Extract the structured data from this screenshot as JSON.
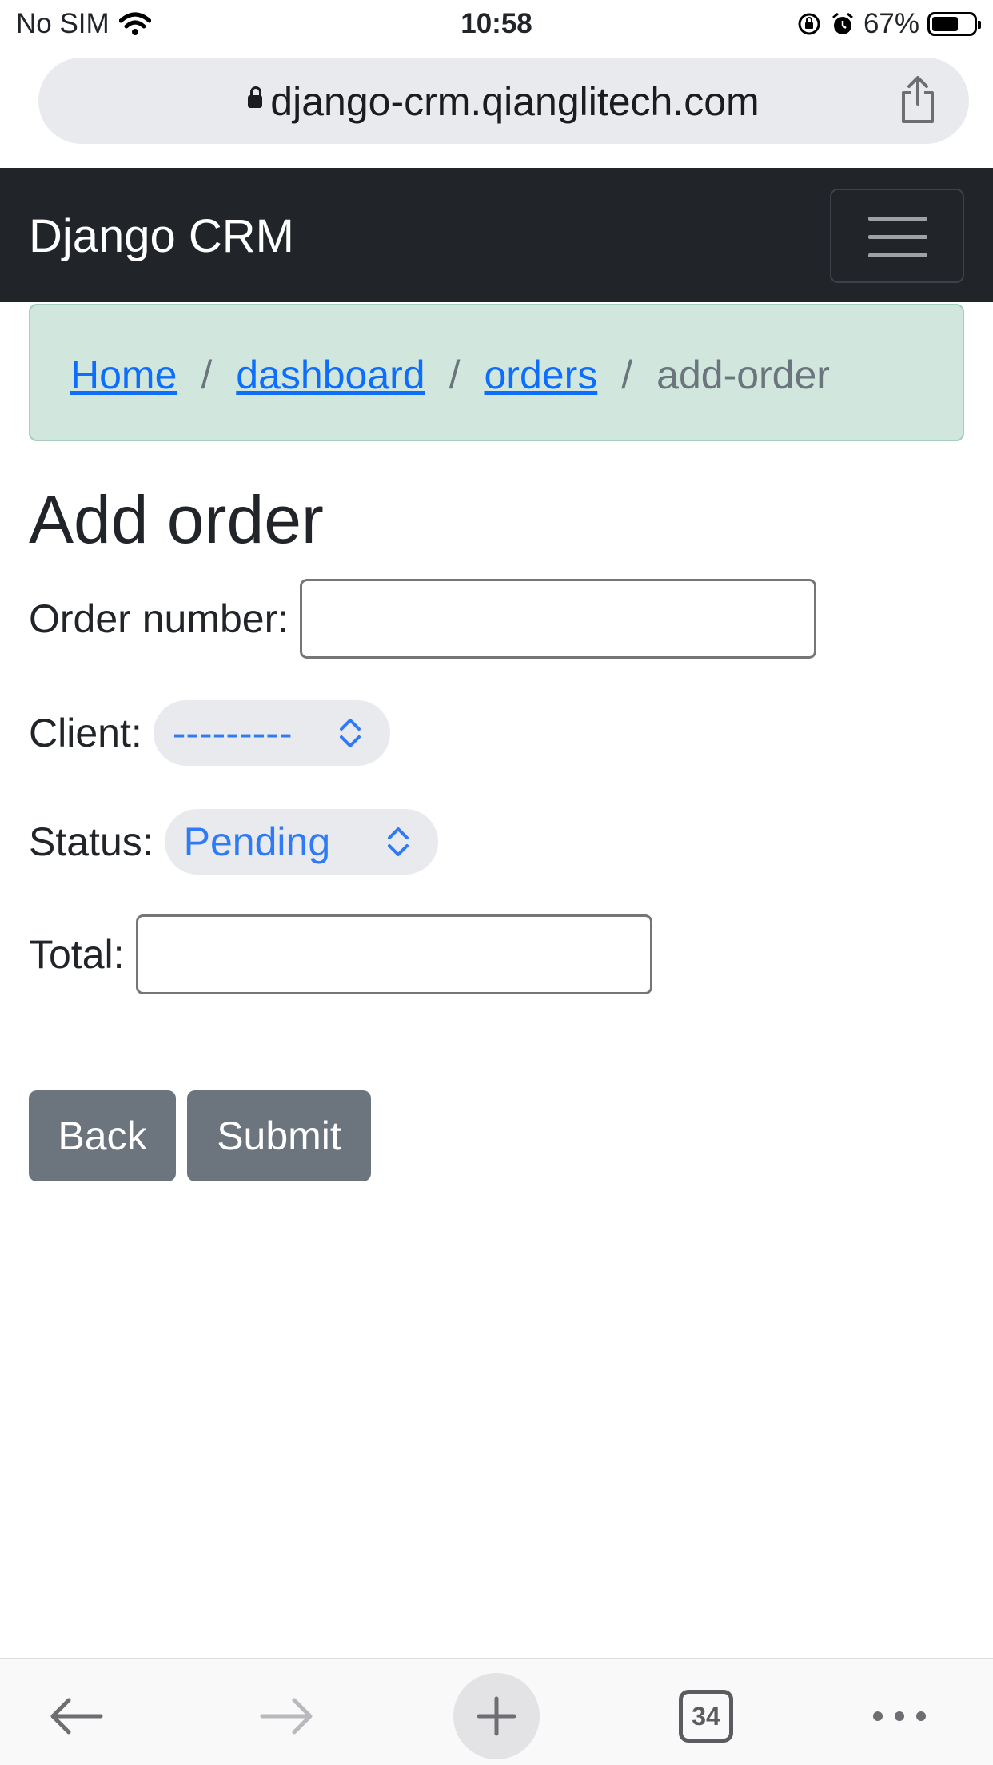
{
  "status_bar": {
    "carrier": "No SIM",
    "time": "10:58",
    "battery_percent": "67%",
    "battery_level": 0.67
  },
  "browser": {
    "url": "django-crm.qianglitech.com",
    "tab_count": "34"
  },
  "navbar": {
    "brand": "Django CRM"
  },
  "breadcrumb": {
    "items": [
      "Home",
      "dashboard",
      "orders"
    ],
    "separator": "/",
    "active": "add-order"
  },
  "page": {
    "title": "Add order"
  },
  "form": {
    "order_number_label": "Order number:",
    "order_number_value": "",
    "client_label": "Client:",
    "client_selected": "---------",
    "status_label": "Status:",
    "status_selected": "Pending",
    "total_label": "Total:",
    "total_value": ""
  },
  "buttons": {
    "back": "Back",
    "submit": "Submit"
  },
  "colors": {
    "navbar_bg": "#212529",
    "breadcrumb_bg": "#d1e7dd",
    "link": "#0d6efd",
    "button_bg": "#6c757d",
    "select_text": "#2f7af5"
  },
  "icons": [
    "wifi-icon",
    "lock-icon",
    "share-icon",
    "orientation-lock-icon",
    "alarm-icon",
    "battery-icon",
    "hamburger-icon",
    "chevron-updown-icon",
    "back-arrow-icon",
    "forward-arrow-icon",
    "plus-icon",
    "tabs-icon",
    "more-icon"
  ]
}
